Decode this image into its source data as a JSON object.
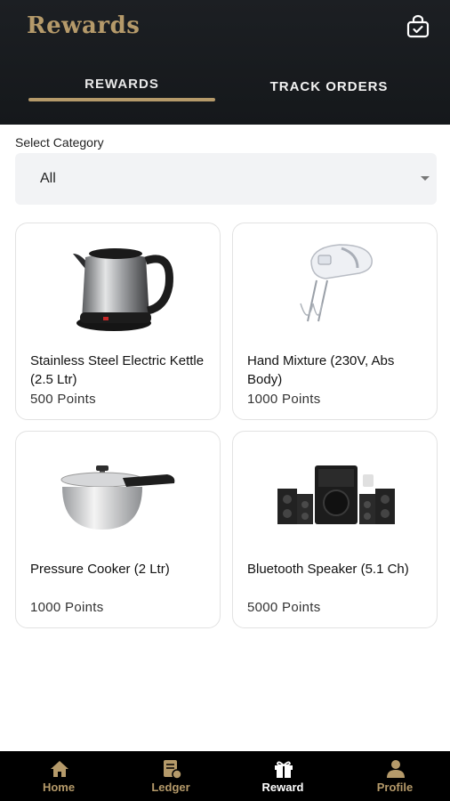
{
  "header": {
    "title": "Rewards",
    "orders_icon": "shopping-bag-check-icon"
  },
  "tabs": [
    {
      "label": "REWARDS",
      "active": true
    },
    {
      "label": "TRACK ORDERS",
      "active": false
    }
  ],
  "filter": {
    "label": "Select Category",
    "selected": "All"
  },
  "products": [
    {
      "name": "Stainless Steel Electric Kettle (2.5 Ltr)",
      "points": "500 Points",
      "image": "electric-kettle"
    },
    {
      "name": "Hand Mixture (230V, Abs Body)",
      "points": "1000 Points",
      "image": "hand-mixer"
    },
    {
      "name": "Pressure Cooker (2 Ltr)",
      "points": "1000 Points",
      "image": "pressure-cooker"
    },
    {
      "name": "Bluetooth Speaker (5.1 Ch)",
      "points": "5000 Points",
      "image": "speaker-system"
    }
  ],
  "nav": [
    {
      "label": "Home",
      "icon": "home-icon",
      "active": false
    },
    {
      "label": "Ledger",
      "icon": "ledger-icon",
      "active": false
    },
    {
      "label": "Reward",
      "icon": "gift-icon",
      "active": true
    },
    {
      "label": "Profile",
      "icon": "user-icon",
      "active": false
    }
  ],
  "colors": {
    "accent": "#b59a6a",
    "header_bg": "#1c1f23",
    "nav_bg": "#000000"
  }
}
